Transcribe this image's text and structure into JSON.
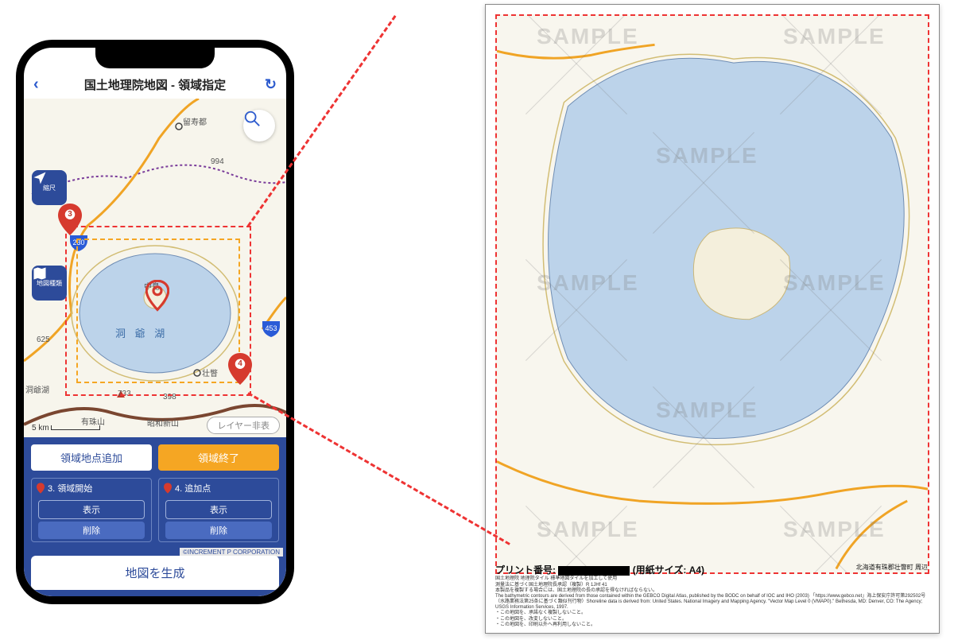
{
  "header": {
    "title": "国土地理院地図 - 領域指定"
  },
  "floatButtons": {
    "scaleLabel": "縮尺",
    "mapTypeLabel": "地図種類"
  },
  "map": {
    "scaleText": "5 km",
    "layerToggle": "レイヤー非表",
    "places": {
      "rusutsu": "留寿都",
      "elev994": "994",
      "nakajima": "中島",
      "toyako": "洞 爺 湖",
      "elev625": "625",
      "toyakoOnsen": "洞爺湖",
      "sobetsu": "壮瞥",
      "elev733": "733",
      "elev398": "398",
      "usuzan": "有珠山",
      "showashinzan": "昭和新山",
      "route230": "230",
      "route453": "453"
    },
    "pins": {
      "p3": "3",
      "p4": "4"
    }
  },
  "panel": {
    "addPoint": "領域地点追加",
    "endRegion": "領域終了",
    "card3": {
      "title": "3. 領域開始",
      "show": "表示",
      "del": "削除"
    },
    "card4": {
      "title": "4. 追加点",
      "show": "表示",
      "del": "削除"
    },
    "copyright": "©INCREMENT P CORPORATION",
    "generate": "地図を生成"
  },
  "print": {
    "watermark": "SAMPLE",
    "label": "プリント番号:",
    "paper": "(用紙サイズ: A4)",
    "location": "北海道有珠郡壮瞥町 周辺",
    "fine1": "国土地理院 地理院タイル 標準地図タイルを加工して使用",
    "fine2": "測量法に基づく国土地理院長承認（複製）R 1JHf 41",
    "fine3": "本製品を複製する場合には、国土地理院の長の承認を得なければならない。",
    "fine4": "The bathymetric contours are derived from those contained within the GEBCO Digital Atlas, published by the BODC on behalf of IOC and IHO (2003) 「https://www.gebco.net」海上保安庁許可第292502号（水路業務法第25条に基づく類似刊行物）Shoreline data is derived from: United States. National Imagery and Mapping Agency. \"Vector Map Level 0 (VMAP0).\" Bethesda, MD: Denver, CO: The Agency; USGS Information Services, 1997.",
    "fine5": "・この地図を、承諾なく複製しないこと。",
    "fine6": "・この地図を、改変しないこと。",
    "fine7": "・この地図を、印刷以外へ再利用しないこと。"
  }
}
